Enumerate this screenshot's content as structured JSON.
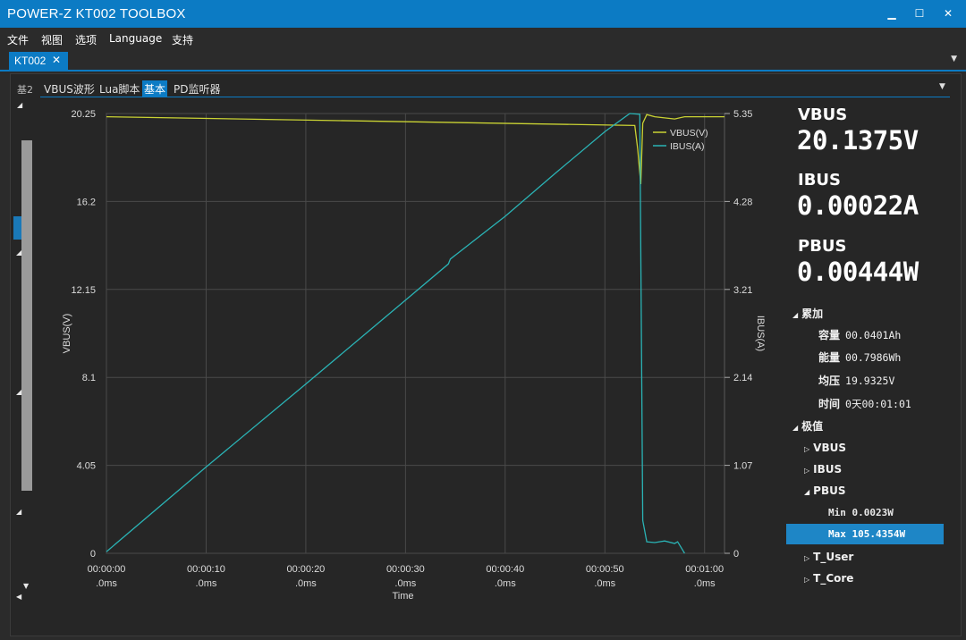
{
  "window": {
    "title": "POWER-Z KT002 TOOLBOX",
    "minimize": "▁",
    "maximize": "☐",
    "close": "✕"
  },
  "menu": [
    "文件",
    "视图",
    "选项",
    "Language",
    "支持"
  ],
  "document_tab": {
    "label": "KT002",
    "close": "✕"
  },
  "left_tab": {
    "label": "基2"
  },
  "subtabs": [
    "VBUS波形",
    "Lua脚本",
    "基本",
    "PD监听器"
  ],
  "active_subtab": 2,
  "readouts": {
    "vbus_label": "VBUS",
    "vbus_value": "20.1375V",
    "ibus_label": "IBUS",
    "ibus_value": "0.00022A",
    "pbus_label": "PBUS",
    "pbus_value": "0.00444W"
  },
  "accum": {
    "header": "累加",
    "rows": [
      {
        "key": "容量",
        "value": "00.0401Ah"
      },
      {
        "key": "能量",
        "value": "00.7986Wh"
      },
      {
        "key": "均压",
        "value": "19.9325V"
      },
      {
        "key": "时间",
        "value": "0天00:01:01"
      }
    ]
  },
  "extremes": {
    "header": "极值",
    "nodes": [
      "VBUS",
      "IBUS",
      "PBUS",
      "T_User",
      "T_Core"
    ],
    "pbus_min": "Min 0.0023W",
    "pbus_max": "Max 105.4354W"
  },
  "colors": {
    "accent": "#0c7bc4",
    "vbus_line": "#c9d233",
    "ibus_line": "#2ab3b5",
    "grid": "#4a4a4a"
  },
  "chart_data": {
    "type": "line",
    "xlabel": "Time",
    "ylabel_left": "VBUS(V)",
    "ylabel_right": "IBUS(A)",
    "x_ticks": [
      "00:00:00\n.0ms",
      "00:00:10\n.0ms",
      "00:00:20\n.0ms",
      "00:00:30\n.0ms",
      "00:00:40\n.0ms",
      "00:00:50\n.0ms",
      "00:01:00\n.0ms"
    ],
    "xlim": [
      0,
      62
    ],
    "left_ticks": [
      "0",
      "4.05",
      "8.1",
      "12.15",
      "16.2",
      "20.25"
    ],
    "right_ticks": [
      "0",
      "1.07",
      "2.14",
      "3.21",
      "4.28",
      "5.35"
    ],
    "ylim_left": [
      0,
      20.25
    ],
    "ylim_right": [
      0,
      5.35
    ],
    "grid": true,
    "legend": "top-right",
    "series": [
      {
        "name": "VBUS(V)",
        "axis": "left",
        "x": [
          0,
          53,
          53.3,
          53.6,
          53.8,
          54.2,
          55,
          56,
          57,
          58,
          60,
          62
        ],
        "y": [
          20.1,
          19.7,
          18.6,
          17.0,
          19.8,
          20.2,
          20.1,
          20.05,
          20.0,
          20.1,
          20.1,
          20.1
        ]
      },
      {
        "name": "IBUS(A)",
        "axis": "right",
        "x": [
          0,
          10,
          20,
          30,
          34.3,
          34.5,
          40,
          45,
          50,
          52.5,
          53.5,
          53.8,
          54.2,
          55,
          56,
          57,
          57.3,
          58
        ],
        "y": [
          0.02,
          1.05,
          2.06,
          3.08,
          3.52,
          3.58,
          4.1,
          4.62,
          5.13,
          5.35,
          5.34,
          0.4,
          0.14,
          0.13,
          0.15,
          0.12,
          0.14,
          0.0
        ]
      }
    ]
  }
}
